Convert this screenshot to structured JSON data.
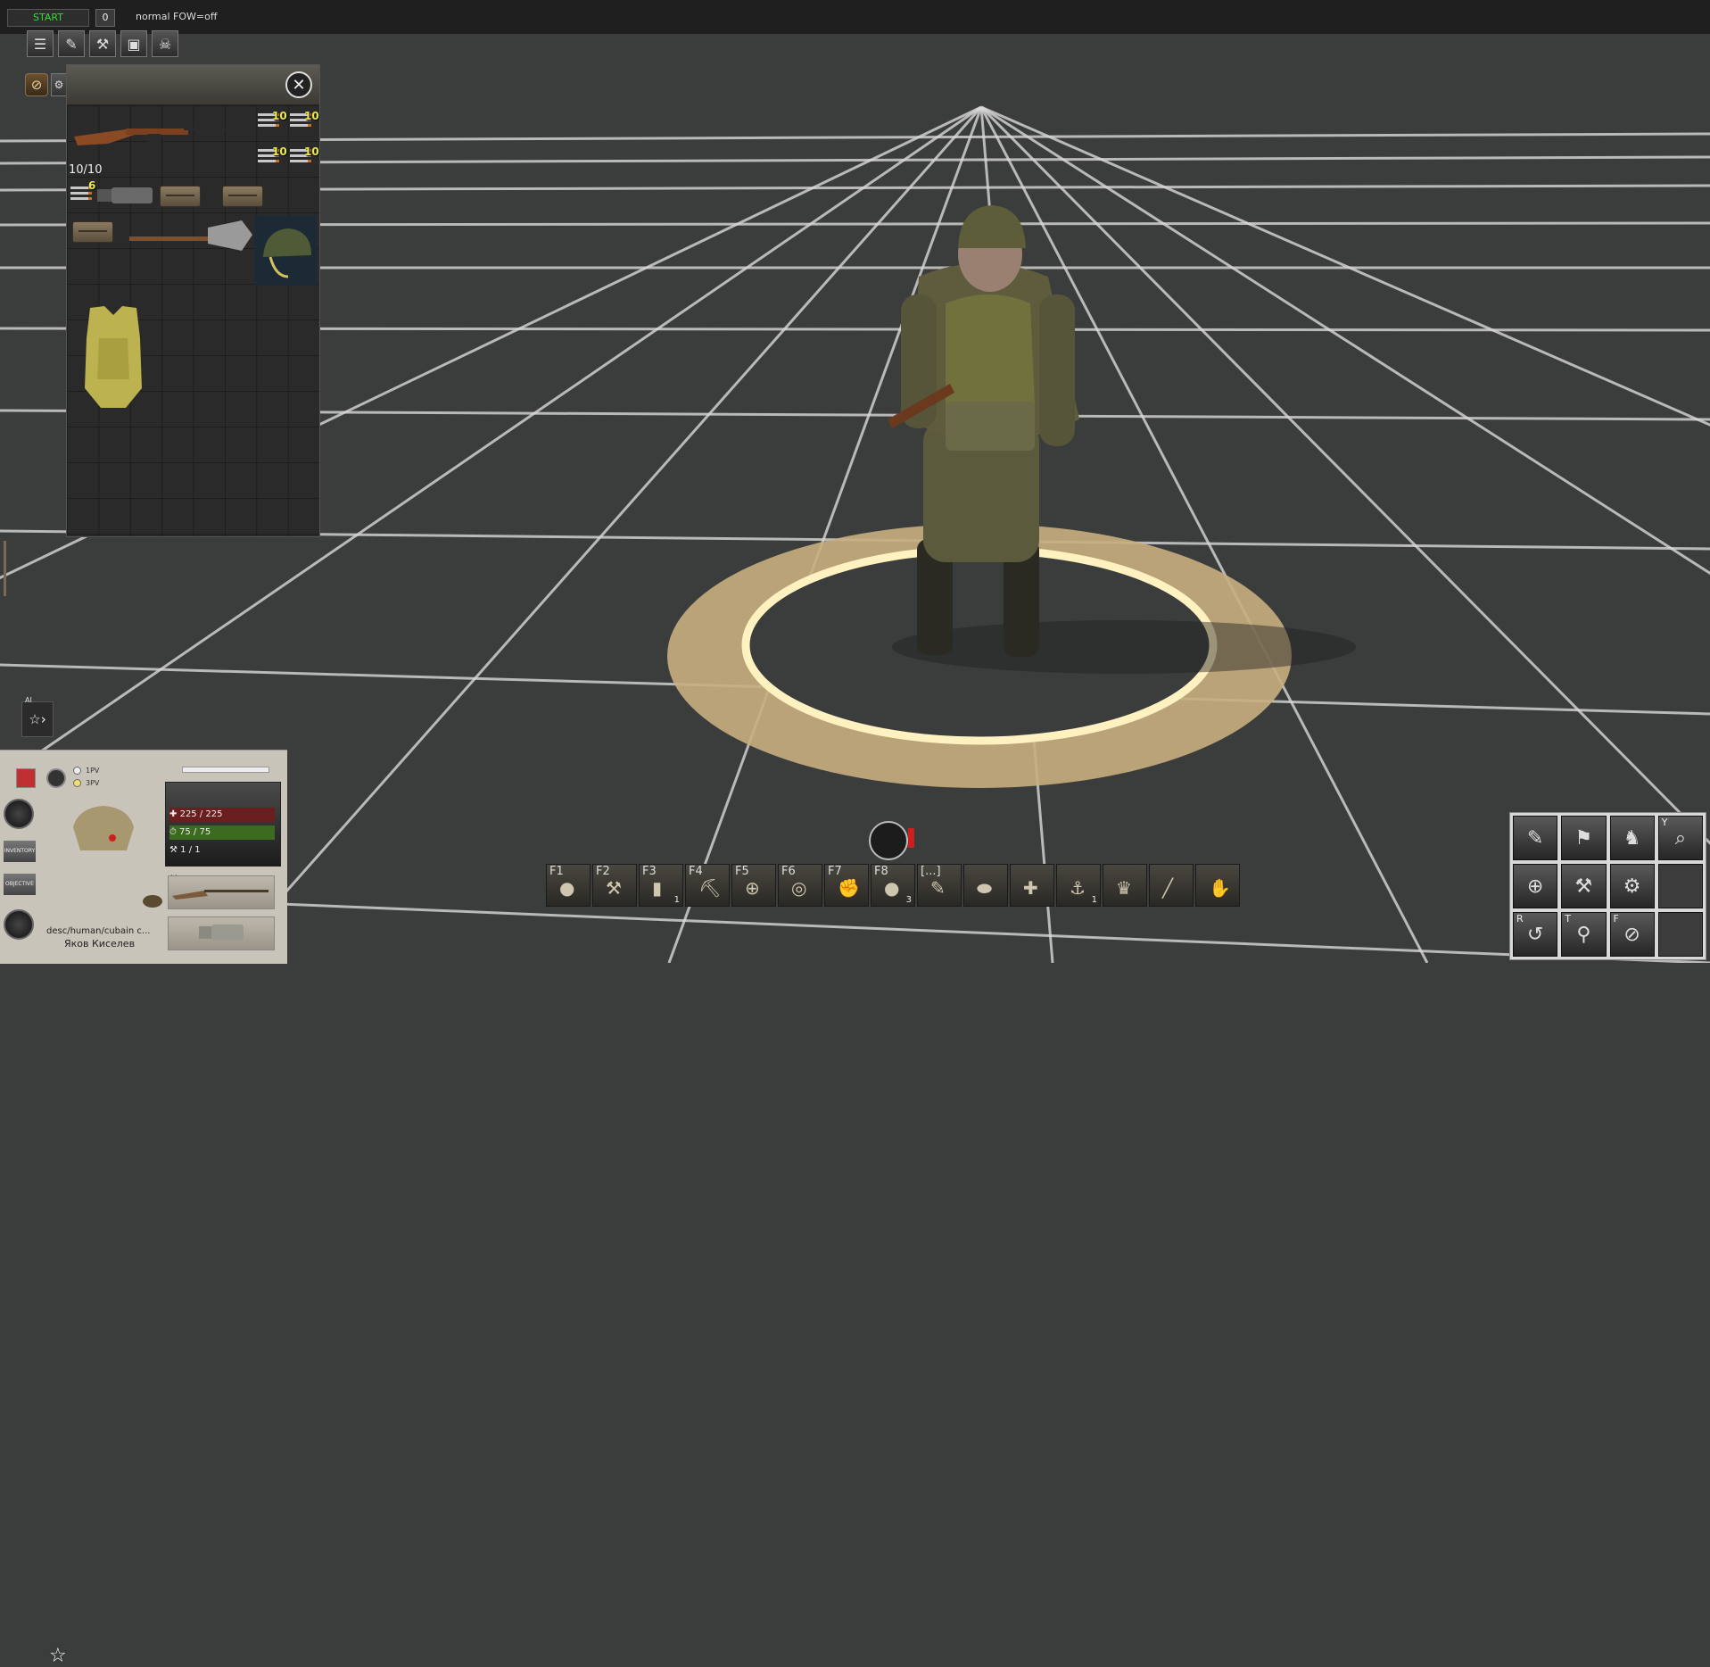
{
  "topbar": {
    "start_label": "START",
    "counter": "0",
    "mode_text": "normal  FOW=off"
  },
  "inventory": {
    "ammo_counts": [
      "10",
      "10",
      "10",
      "10"
    ],
    "magazine_count": "10/10",
    "loose_ammo": "6"
  },
  "squad": {
    "tag": "AI"
  },
  "unit": {
    "view_first": "1PV",
    "view_third": "3PV",
    "side_buttons": [
      "INVENTORY",
      "OBJECTIVE"
    ],
    "health": "225 / 225",
    "stamina": "75 / 75",
    "tools": "1 / 1",
    "path": "desc/human/cubain c...",
    "name": "Яков Киселев",
    "rank_label": "**"
  },
  "hotbar": [
    {
      "key": "F1",
      "badge": ""
    },
    {
      "key": "F2",
      "badge": ""
    },
    {
      "key": "F3",
      "badge": "1"
    },
    {
      "key": "F4",
      "badge": ""
    },
    {
      "key": "F5",
      "badge": ""
    },
    {
      "key": "F6",
      "badge": ""
    },
    {
      "key": "F7",
      "badge": ""
    },
    {
      "key": "F8",
      "badge": "3"
    },
    {
      "key": "[...]",
      "badge": ""
    },
    {
      "key": "",
      "badge": ""
    },
    {
      "key": "",
      "badge": ""
    },
    {
      "key": "",
      "badge": "1"
    },
    {
      "key": "",
      "badge": ""
    },
    {
      "key": "",
      "badge": ""
    },
    {
      "key": "",
      "badge": ""
    }
  ],
  "actions": {
    "key_undo": "R",
    "key_shovel": "T",
    "key_aim": "F",
    "key_zoom": "Y"
  },
  "colors": {
    "ring_outer": "#c9ae80",
    "ring_inner": "#fff2c0",
    "ground": "#3a3d3b",
    "grid_line": "#d8d8d8",
    "start_text": "#33dd33"
  }
}
